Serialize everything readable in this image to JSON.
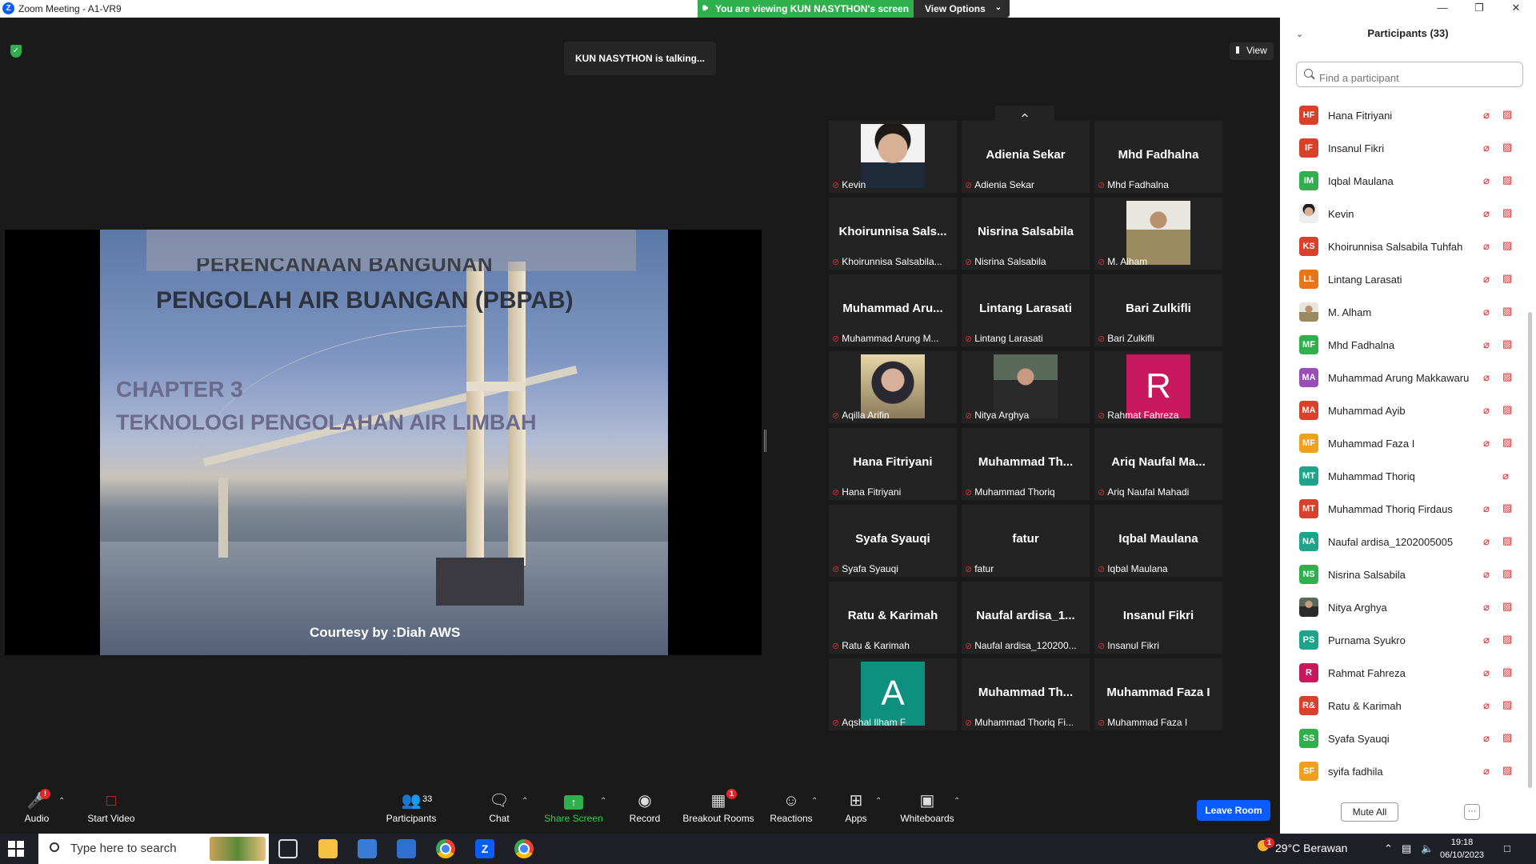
{
  "window": {
    "title": "Zoom Meeting - A1-VR9"
  },
  "banner": {
    "viewing_text": "You are viewing KUN NASYTHON's screen",
    "view_options_label": "View Options"
  },
  "main": {
    "talking_text": "KUN NASYTHON is talking...",
    "view_label": "View"
  },
  "slide": {
    "line1": "PERENCANAAN BANGUNAN",
    "line2": "PENGOLAH AIR BUANGAN (PBPAB)",
    "chapter": "CHAPTER  3",
    "subtitle": "TEKNOLOGI PENGOLAHAN AIR LIMBAH",
    "courtesy": "Courtesy by :Diah AWS"
  },
  "gallery": [
    {
      "name": "",
      "label": "Kevin",
      "photo": "kevin"
    },
    {
      "name": "Adienia Sekar",
      "label": "Adienia Sekar"
    },
    {
      "name": "Mhd Fadhalna",
      "label": "Mhd Fadhalna"
    },
    {
      "name": "Khoirunnisa  Sals...",
      "label": "Khoirunnisa Salsabila..."
    },
    {
      "name": "Nisrina Salsabila",
      "label": "Nisrina Salsabila"
    },
    {
      "name": "",
      "label": "M. Alham",
      "photo": "alham"
    },
    {
      "name": "Muhammad  Aru...",
      "label": "Muhammad Arung M..."
    },
    {
      "name": "Lintang Larasati",
      "label": "Lintang Larasati"
    },
    {
      "name": "Bari Zulkifli",
      "label": "Bari Zulkifli"
    },
    {
      "name": "",
      "label": "Aqilla Arifin",
      "photo": "aqilla"
    },
    {
      "name": "",
      "label": "Nitya Arghya",
      "photo": "nitya"
    },
    {
      "name": "",
      "label": "Rahmat Fahreza",
      "letter": "R",
      "color": "#c8195e"
    },
    {
      "name": "Hana Fitriyani",
      "label": "Hana Fitriyani"
    },
    {
      "name": "Muhammad  Th...",
      "label": "Muhammad Thoriq"
    },
    {
      "name": "Ariq Naufal Ma...",
      "label": "Ariq Naufal Mahadi"
    },
    {
      "name": "Syafa Syauqi",
      "label": "Syafa Syauqi"
    },
    {
      "name": "fatur",
      "label": "fatur"
    },
    {
      "name": "Iqbal Maulana",
      "label": "Iqbal Maulana"
    },
    {
      "name": "Ratu & Karimah",
      "label": "Ratu & Karimah"
    },
    {
      "name": "Naufal  ardisa_1...",
      "label": "Naufal ardisa_120200..."
    },
    {
      "name": "Insanul Fikri",
      "label": "Insanul Fikri"
    },
    {
      "name": "",
      "label": "Aqshal Ilham F",
      "letter": "A",
      "color": "#0f8f7e"
    },
    {
      "name": "Muhammad  Th...",
      "label": "Muhammad Thoriq Fi..."
    },
    {
      "name": "Muhammad Faza I",
      "label": "Muhammad Faza I"
    }
  ],
  "toolbar": {
    "audio": "Audio",
    "start_video": "Start Video",
    "participants": "Participants",
    "participants_count": "33",
    "chat": "Chat",
    "share_screen": "Share Screen",
    "record": "Record",
    "breakout_rooms": "Breakout Rooms",
    "reactions": "Reactions",
    "apps": "Apps",
    "whiteboards": "Whiteboards",
    "leave": "Leave Room",
    "audio_badge": "!",
    "breakout_badge": "1"
  },
  "panel": {
    "title": "Participants (33)",
    "search_placeholder": "Find a participant",
    "mute_all": "Mute All",
    "more": "···",
    "participants": [
      {
        "initials": "HF",
        "name": "Hana Fitriyani",
        "color": "#d9412b",
        "cam_off": true
      },
      {
        "initials": "IF",
        "name": "Insanul Fikri",
        "color": "#d9412b",
        "cam_off": true
      },
      {
        "initials": "IM",
        "name": "Iqbal Maulana",
        "color": "#2fb04c",
        "cam_off": true
      },
      {
        "initials": "",
        "name": "Kevin",
        "photo": "kevin",
        "cam_off": true
      },
      {
        "initials": "KS",
        "name": "Khoirunnisa Salsabila Tuhfah",
        "color": "#d9412b",
        "cam_off": true
      },
      {
        "initials": "LL",
        "name": "Lintang Larasati",
        "color": "#e8751a",
        "cam_off": true
      },
      {
        "initials": "",
        "name": "M. Alham",
        "photo": "alham",
        "cam_off": true
      },
      {
        "initials": "MF",
        "name": "Mhd Fadhalna",
        "color": "#2fb04c",
        "cam_off": true
      },
      {
        "initials": "MA",
        "name": "Muhammad Arung Makkawaru",
        "color": "#9b4db8",
        "cam_off": true
      },
      {
        "initials": "MA",
        "name": "Muhammad Ayib",
        "color": "#d9412b",
        "cam_off": true
      },
      {
        "initials": "MF",
        "name": "Muhammad Faza I",
        "color": "#f0a020",
        "cam_off": true
      },
      {
        "initials": "MT",
        "name": "Muhammad Thoriq",
        "color": "#1fa38a",
        "cam_off": false
      },
      {
        "initials": "MT",
        "name": "Muhammad Thoriq Firdaus",
        "color": "#d9412b",
        "cam_off": true
      },
      {
        "initials": "NA",
        "name": "Naufal ardisa_1202005005",
        "color": "#1fa38a",
        "cam_off": true
      },
      {
        "initials": "NS",
        "name": "Nisrina Salsabila",
        "color": "#2fb04c",
        "cam_off": true
      },
      {
        "initials": "",
        "name": "Nitya Arghya",
        "photo": "nitya",
        "cam_off": true
      },
      {
        "initials": "PS",
        "name": "Purnama Syukro",
        "color": "#1fa38a",
        "cam_off": true
      },
      {
        "initials": "R",
        "name": "Rahmat Fahreza",
        "color": "#c8195e",
        "cam_off": true
      },
      {
        "initials": "R&",
        "name": "Ratu & Karimah",
        "color": "#d9412b",
        "cam_off": true
      },
      {
        "initials": "SS",
        "name": "Syafa Syauqi",
        "color": "#2fb04c",
        "cam_off": true
      },
      {
        "initials": "SF",
        "name": "syifa fadhila",
        "color": "#f0a020",
        "cam_off": true
      }
    ]
  },
  "taskbar": {
    "search_placeholder": "Type here to search",
    "weather": "29°C  Berawan",
    "time": "19:18",
    "date": "06/10/2023",
    "notif_count": "1"
  }
}
